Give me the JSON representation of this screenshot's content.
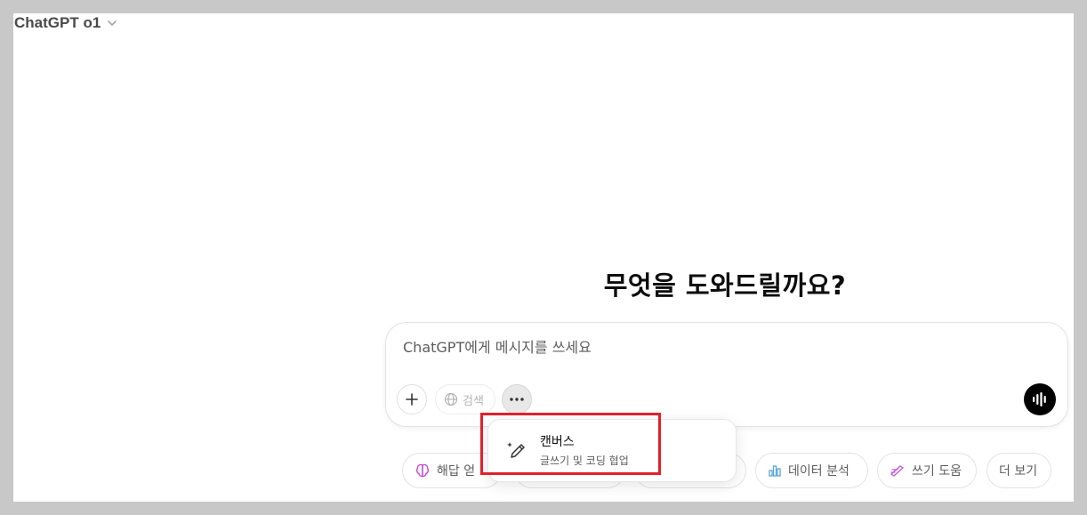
{
  "header": {
    "model_name": "ChatGPT o1"
  },
  "main": {
    "headline": "무엇을 도와드릴까요?"
  },
  "composer": {
    "placeholder": "ChatGPT에게 메시지를 쓰세요",
    "search_label": "검색"
  },
  "tools_menu": {
    "items": [
      {
        "title": "캔버스",
        "subtitle": "글쓰기 및 코딩 협업",
        "icon": "pencil-sparkle-icon"
      }
    ]
  },
  "suggestions": [
    {
      "label": "해답 얻기",
      "visible_label": "해답 얻",
      "icon": "brain-icon",
      "color": "#c04fd1"
    },
    {
      "label": "",
      "icon": ""
    },
    {
      "label": "",
      "icon": ""
    },
    {
      "label": "데이터 분석",
      "icon": "bar-chart-icon",
      "color": "#5aa4d6"
    },
    {
      "label": "쓰기 도움",
      "icon": "pen-icon",
      "color": "#c05bd6"
    },
    {
      "label": "더 보기",
      "icon": ""
    }
  ],
  "colors": {
    "accent_highlight": "#e2202a",
    "voice_button": "#000000"
  }
}
